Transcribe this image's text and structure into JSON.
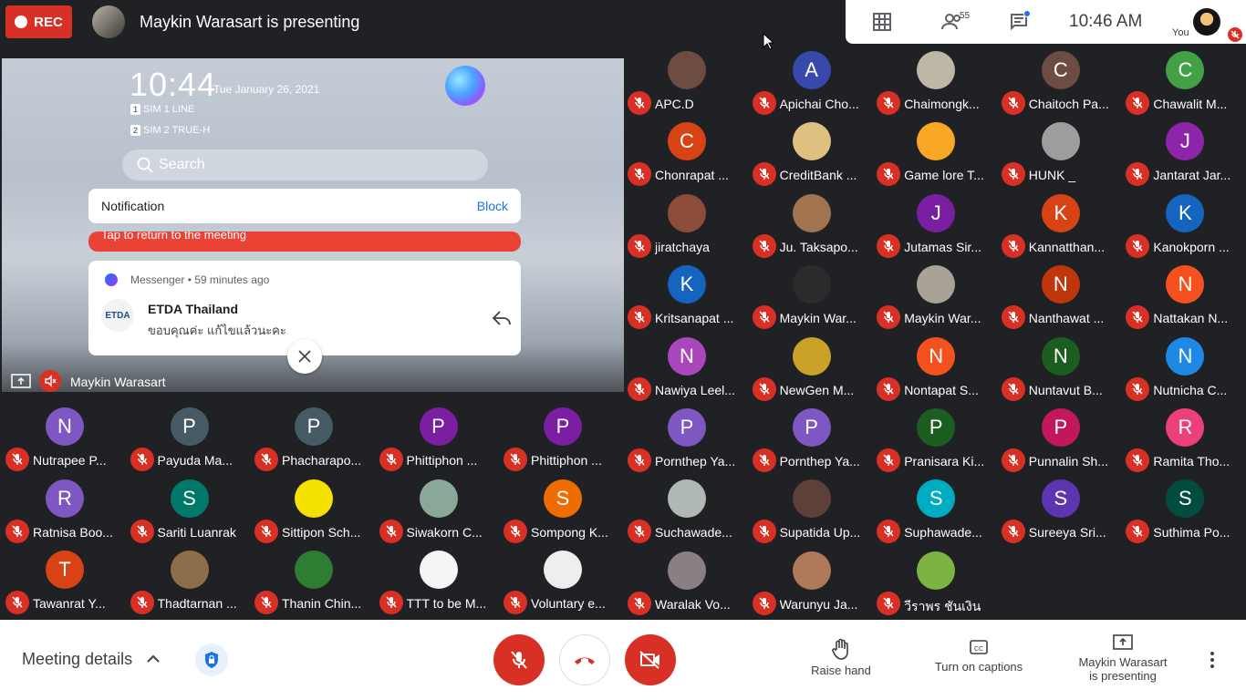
{
  "top": {
    "rec_label": "REC",
    "presenting_title": "Maykin Warasart is presenting",
    "participant_count": "55",
    "clock": "10:46  AM",
    "you_label": "You"
  },
  "presentation": {
    "phone_time": "10:44",
    "phone_date": "Tue January 26, 2021",
    "sim1": "SIM 1 LINE",
    "sim2": "SIM 2 TRUE-H",
    "search_placeholder": "Search",
    "notification_label": "Notification",
    "block_label": "Block",
    "return_text": "Tap to return to the meeting",
    "msg_app": "Messenger • 59 minutes ago",
    "msg_avatar": "ETDA",
    "msg_sender": "ETDA Thailand",
    "msg_text": "ขอบคุณค่ะ แก้ไขแล้วนะคะ",
    "presenter_name": "Maykin Warasart"
  },
  "left_tiles": [
    {
      "initial": "N",
      "name": "Nutrapee P...",
      "color": "#7e57c2"
    },
    {
      "initial": "P",
      "name": "Payuda Ma...",
      "color": "#455a64"
    },
    {
      "initial": "P",
      "name": "Phacharapo...",
      "color": "#455a64"
    },
    {
      "initial": "P",
      "name": "Phittiphon ...",
      "color": "#7b1fa2"
    },
    {
      "initial": "P",
      "name": "Phittiphon ...",
      "color": "#7b1fa2"
    },
    {
      "initial": "R",
      "name": "Ratnisa Boo...",
      "color": "#7e57c2"
    },
    {
      "initial": "S",
      "name": "Sariti Luanrak",
      "color": "#00796b"
    },
    {
      "initial": "",
      "name": "Sittipon Sch...",
      "color": "#f5e100"
    },
    {
      "initial": "",
      "name": "Siwakorn C...",
      "color": "#8aa89a"
    },
    {
      "initial": "S",
      "name": "Sompong K...",
      "color": "#ef6c00"
    },
    {
      "initial": "T",
      "name": "Tawanrat Y...",
      "color": "#d84315"
    },
    {
      "initial": "",
      "name": "Thadtarnan ...",
      "color": "#8d6e4a"
    },
    {
      "initial": "",
      "name": "Thanin Chin...",
      "color": "#2e7d32"
    },
    {
      "initial": "",
      "name": "TTT to be M...",
      "color": "#f5f5f5"
    },
    {
      "initial": "",
      "name": "Voluntary e...",
      "color": "#eeeeee"
    }
  ],
  "right_tiles": [
    {
      "initial": "",
      "name": "APC.D",
      "color": "#6d4c41"
    },
    {
      "initial": "A",
      "name": "Apichai Cho...",
      "color": "#3949ab"
    },
    {
      "initial": "",
      "name": "Chaimongk...",
      "color": "#bdb7a6"
    },
    {
      "initial": "C",
      "name": "Chaitoch Pa...",
      "color": "#6d4c41"
    },
    {
      "initial": "C",
      "name": "Chawalit M...",
      "color": "#43a047"
    },
    {
      "initial": "C",
      "name": "Chonrapat ...",
      "color": "#d84315"
    },
    {
      "initial": "",
      "name": "CreditBank ...",
      "color": "#e0c080"
    },
    {
      "initial": "",
      "name": "Game lore T...",
      "color": "#f9a825"
    },
    {
      "initial": "",
      "name": "HUNK _",
      "color": "#9e9e9e"
    },
    {
      "initial": "J",
      "name": "Jantarat Jar...",
      "color": "#8e24aa"
    },
    {
      "initial": "",
      "name": "jiratchaya",
      "color": "#8d4b3a"
    },
    {
      "initial": "",
      "name": "Ju. Taksapo...",
      "color": "#a1734e"
    },
    {
      "initial": "J",
      "name": "Jutamas Sir...",
      "color": "#7b1fa2"
    },
    {
      "initial": "K",
      "name": "Kannatthan...",
      "color": "#d84315"
    },
    {
      "initial": "K",
      "name": "Kanokporn ...",
      "color": "#1565c0"
    },
    {
      "initial": "K",
      "name": "Kritsanapat ...",
      "color": "#1565c0"
    },
    {
      "initial": "",
      "name": "Maykin War...",
      "color": "#2b2b2b"
    },
    {
      "initial": "",
      "name": "Maykin War...",
      "color": "#a9a296"
    },
    {
      "initial": "N",
      "name": "Nanthawat ...",
      "color": "#bf360c"
    },
    {
      "initial": "N",
      "name": "Nattakan N...",
      "color": "#f4511e"
    },
    {
      "initial": "N",
      "name": "Nawiya Leel...",
      "color": "#ab47bc"
    },
    {
      "initial": "",
      "name": "NewGen M...",
      "color": "#c9a227"
    },
    {
      "initial": "N",
      "name": "Nontapat S...",
      "color": "#f4511e"
    },
    {
      "initial": "N",
      "name": "Nuntavut B...",
      "color": "#1b5e20"
    },
    {
      "initial": "N",
      "name": "Nutnicha C...",
      "color": "#1e88e5"
    },
    {
      "initial": "P",
      "name": "Pornthep Ya...",
      "color": "#7e57c2"
    },
    {
      "initial": "P",
      "name": "Pornthep Ya...",
      "color": "#7e57c2"
    },
    {
      "initial": "P",
      "name": "Pranisara Ki...",
      "color": "#1b5e20"
    },
    {
      "initial": "P",
      "name": "Punnalin Sh...",
      "color": "#c2185b"
    },
    {
      "initial": "R",
      "name": "Ramita Tho...",
      "color": "#ec407a"
    },
    {
      "initial": "",
      "name": "Suchawade...",
      "color": "#b0b8b4"
    },
    {
      "initial": "",
      "name": "Supatida Up...",
      "color": "#5d4037"
    },
    {
      "initial": "S",
      "name": "Suphawade...",
      "color": "#00acc1"
    },
    {
      "initial": "S",
      "name": "Sureeya Sri...",
      "color": "#5e35b1"
    },
    {
      "initial": "S",
      "name": "Suthima Po...",
      "color": "#004d40"
    },
    {
      "initial": "",
      "name": "Waralak Vo...",
      "color": "#8a7f82"
    },
    {
      "initial": "",
      "name": "Warunyu Ja...",
      "color": "#b07a5a"
    },
    {
      "initial": "",
      "name": "วีราพร ชันเงิน",
      "color": "#7cb342"
    }
  ],
  "bottom": {
    "meeting_details": "Meeting details",
    "raise_hand": "Raise hand",
    "captions": "Turn on captions",
    "presenting_line1": "Maykin Warasart",
    "presenting_line2": "is presenting"
  },
  "colors": {
    "danger": "#d93025",
    "accent": "#1a73e8"
  }
}
